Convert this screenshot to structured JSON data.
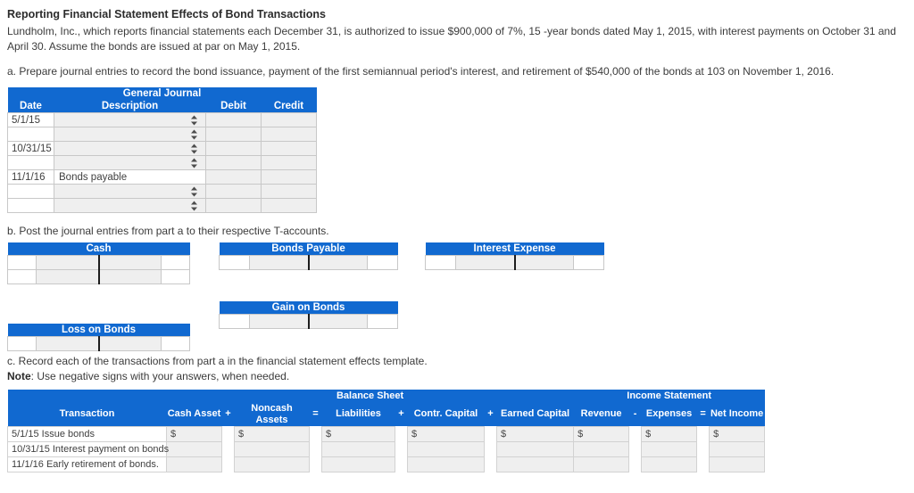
{
  "question": {
    "title": "Reporting Financial Statement Effects of Bond Transactions",
    "body": "Lundholm, Inc., which reports financial statements each December 31, is authorized to issue $900,000 of 7%, 15 -year bonds dated May 1, 2015, with interest payments on October 31 and April 30. Assume the bonds are issued at par on May 1, 2015.",
    "part_a": "a. Prepare journal entries to record the bond issuance, payment of the first semiannual period's interest, and retirement of $540,000 of the bonds at 103 on November 1, 2016.",
    "part_b": "b. Post the journal entries from part a to their respective T-accounts.",
    "part_c": "c. Record each of the transactions from part a in the financial statement effects template.",
    "note_label": "Note",
    "note_text": ": Use negative signs with your answers, when needed."
  },
  "colors": {
    "header_blue": "#1169d0",
    "cell_gray": "#efefef",
    "border_gray": "#c8c8c8",
    "text": "#3b3b3b"
  },
  "general_journal": {
    "title": "General Journal",
    "columns": [
      "Date",
      "Description",
      "Debit",
      "Credit"
    ],
    "rows": [
      {
        "date": "5/1/15",
        "description": "",
        "has_select": true,
        "debit": "",
        "credit": ""
      },
      {
        "date": "",
        "description": "",
        "has_select": true,
        "debit": "",
        "credit": ""
      },
      {
        "date": "10/31/15",
        "description": "",
        "has_select": true,
        "debit": "",
        "credit": ""
      },
      {
        "date": "",
        "description": "",
        "has_select": true,
        "debit": "",
        "credit": ""
      },
      {
        "date": "11/1/16",
        "description": "Bonds payable",
        "has_select": false,
        "debit": "",
        "credit": ""
      },
      {
        "date": "",
        "description": "",
        "has_select": true,
        "debit": "",
        "credit": ""
      },
      {
        "date": "",
        "description": "",
        "has_select": true,
        "debit": "",
        "credit": ""
      }
    ]
  },
  "t_accounts": [
    {
      "id": "cash",
      "title": "Cash",
      "rows": 2
    },
    {
      "id": "bonds-payable",
      "title": "Bonds Payable",
      "rows": 1
    },
    {
      "id": "interest-expense",
      "title": "Interest Expense",
      "rows": 1
    },
    {
      "id": "gain-on-bonds",
      "title": "Gain on Bonds",
      "rows": 1
    },
    {
      "id": "loss-on-bonds",
      "title": "Loss on Bonds",
      "rows": 1
    }
  ],
  "fse": {
    "group_headers": [
      "Balance Sheet",
      "Income Statement"
    ],
    "transaction_header": "Transaction",
    "columns": [
      {
        "label": "Cash Asset",
        "op_after": "+"
      },
      {
        "label": "Noncash Assets",
        "op_after": "="
      },
      {
        "label": "Liabilities",
        "op_after": "+"
      },
      {
        "label": "Contr. Capital",
        "op_after": "+"
      },
      {
        "label": "Earned Capital",
        "op_after": ""
      },
      {
        "label": "Revenue",
        "op_after": "-"
      },
      {
        "label": "Expenses",
        "op_after": "="
      },
      {
        "label": "Net Income",
        "op_after": ""
      }
    ],
    "rows": [
      {
        "transaction": "5/1/15 Issue bonds",
        "values": [
          "$",
          "$",
          "$",
          "$",
          "$",
          "$",
          "$",
          "$"
        ]
      },
      {
        "transaction": "10/31/15 Interest payment on bonds",
        "values": [
          "",
          "",
          "",
          "",
          "",
          "",
          "",
          ""
        ]
      },
      {
        "transaction": "11/1/16 Early retirement of bonds.",
        "values": [
          "",
          "",
          "",
          "",
          "",
          "",
          "",
          ""
        ]
      }
    ]
  }
}
